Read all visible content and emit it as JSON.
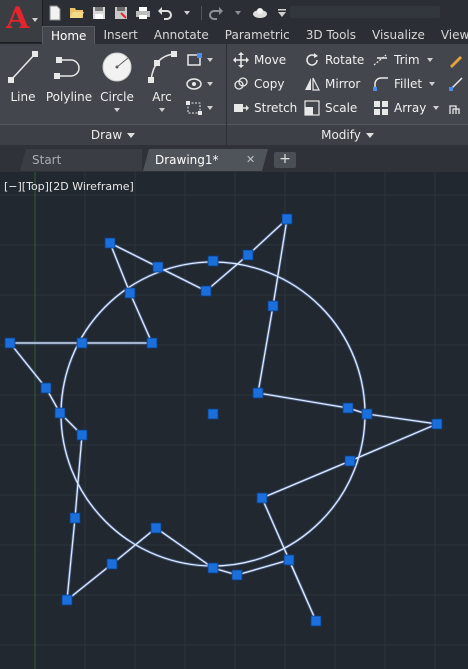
{
  "app": {
    "logo_letter": "A"
  },
  "ribbon_tabs": [
    "Home",
    "Insert",
    "Annotate",
    "Parametric",
    "3D Tools",
    "Visualize",
    "View"
  ],
  "draw_panel": {
    "title": "Draw",
    "tools": [
      {
        "label": "Line",
        "icon": "line-icon"
      },
      {
        "label": "Polyline",
        "icon": "polyline-icon"
      },
      {
        "label": "Circle",
        "icon": "circle-icon"
      },
      {
        "label": "Arc",
        "icon": "arc-icon"
      }
    ]
  },
  "modify_panel": {
    "title": "Modify",
    "tools": [
      {
        "label": "Move",
        "icon": "move-icon"
      },
      {
        "label": "Rotate",
        "icon": "rotate-icon"
      },
      {
        "label": "Trim",
        "icon": "trim-icon"
      },
      {
        "label": "Copy",
        "icon": "copy-icon"
      },
      {
        "label": "Mirror",
        "icon": "mirror-icon"
      },
      {
        "label": "Fillet",
        "icon": "fillet-icon"
      },
      {
        "label": "Stretch",
        "icon": "stretch-icon"
      },
      {
        "label": "Scale",
        "icon": "scale-icon"
      },
      {
        "label": "Array",
        "icon": "array-icon"
      }
    ]
  },
  "doc_tabs": [
    {
      "label": "Start",
      "active": false
    },
    {
      "label": "Drawing1*",
      "active": true
    }
  ],
  "doc_tab_close": "✕",
  "doc_tab_new": "+",
  "viewport": {
    "label": "[−][Top][2D Wireframe]"
  },
  "colors": {
    "accent_tab": "#43474d",
    "model_space": "#212830",
    "entity": "#a9c8ff",
    "grip": "#1a6fdc"
  }
}
